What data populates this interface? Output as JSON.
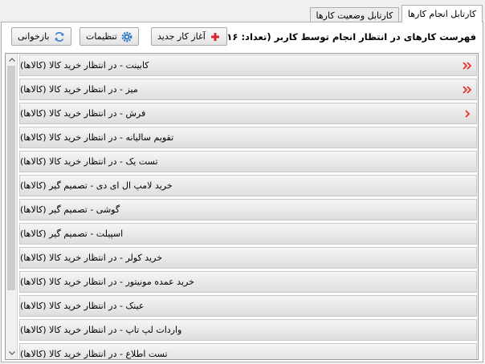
{
  "tabs": [
    {
      "label": "کارتابل انجام کارها",
      "active": true
    },
    {
      "label": "کارتابل وضعیت کارها",
      "active": false
    }
  ],
  "toolbar": {
    "title": "فهرست کارهای در انتظار انجام توسط کاربر (تعداد: ۱۶)",
    "new_label": "آغاز کار جدید",
    "settings_label": "تنظیمات",
    "refresh_label": "بازخوانی"
  },
  "list": {
    "items": [
      {
        "label": "کابینت - در انتظار خرید کالا (کالاها)",
        "marker": "double"
      },
      {
        "label": "میز - در انتظار خرید کالا (کالاها)",
        "marker": "double"
      },
      {
        "label": "فرش - در انتظار خرید کالا (کالاها)",
        "marker": "single"
      },
      {
        "label": "تقویم سالیانه - در انتظار خرید کالا (کالاها)",
        "marker": "none"
      },
      {
        "label": "تست یک - در انتظار خرید کالا (کالاها)",
        "marker": "none"
      },
      {
        "label": "خرید لامپ ال ای دی - تصمیم گیر (کالاها)",
        "marker": "none"
      },
      {
        "label": "گوشی - تصمیم گیر (کالاها)",
        "marker": "none"
      },
      {
        "label": "اسپیلت - تصمیم گیر (کالاها)",
        "marker": "none"
      },
      {
        "label": "خرید کولر - در انتظار خرید کالا (کالاها)",
        "marker": "none"
      },
      {
        "label": "خرید عمده مونیتور - در انتظار خرید کالا (کالاها)",
        "marker": "none"
      },
      {
        "label": "عینک - در انتظار خرید کالا (کالاها)",
        "marker": "none"
      },
      {
        "label": "واردات لپ تاپ - در انتظار خرید کالا (کالاها)",
        "marker": "none"
      },
      {
        "label": "تست اطلاع - در انتظار خرید کالا (کالاها)",
        "marker": "none"
      }
    ]
  },
  "icons": {
    "new": "plus-icon",
    "settings": "gear-icon",
    "refresh": "refresh-icon",
    "marker_double": "double-chevron-icon",
    "marker_single": "chevron-icon"
  },
  "colors": {
    "marker": "#e8312a",
    "new_plus": "#d9262c",
    "settings_gear": "#2f79c2",
    "refresh": "#3b7ad0"
  }
}
